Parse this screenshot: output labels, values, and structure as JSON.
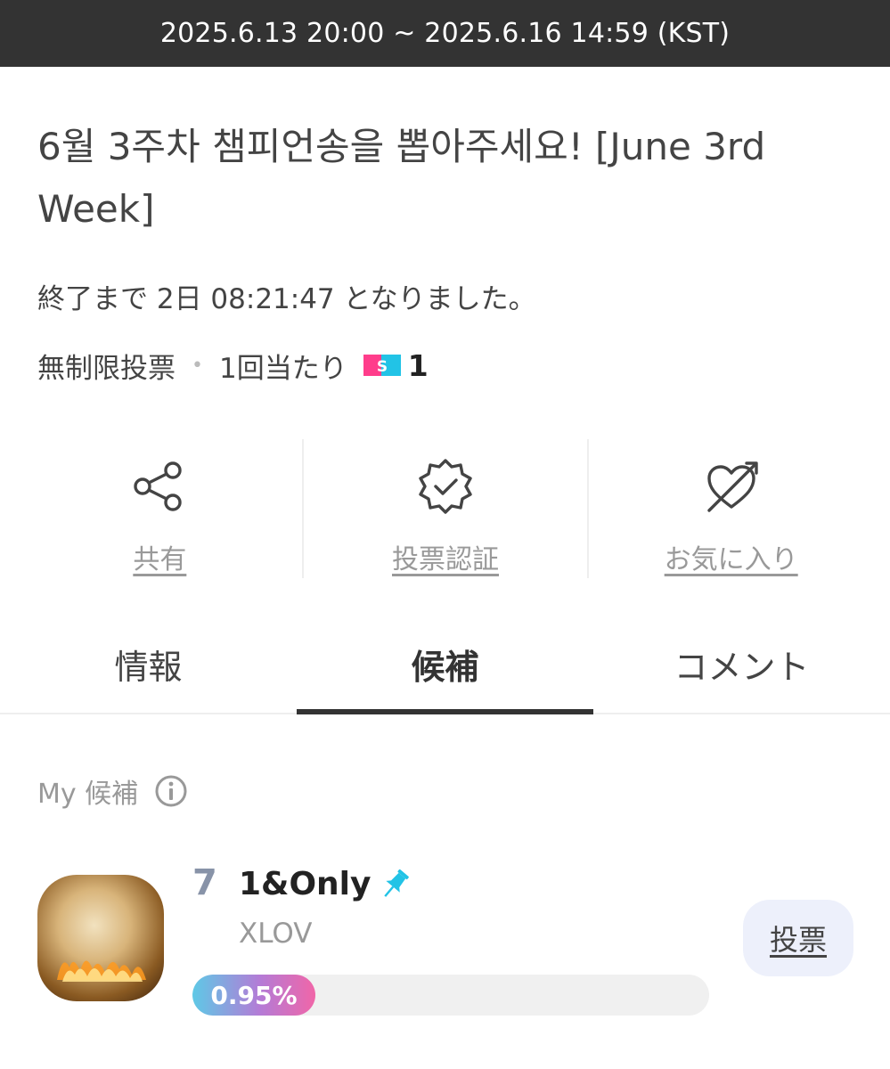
{
  "banner": {
    "period": "2025.6.13 20:00 ~ 2025.6.16 14:59 (KST)"
  },
  "vote": {
    "title": "6월 3주차 챔피언송을 뽑아주세요! [June 3rd Week]",
    "ends_in": "終了まで 2日 08:21:47 となりました。",
    "type": "無制限投票",
    "separator": "•",
    "per_vote": "1回当たり",
    "point_icon": "point-ticket-icon",
    "point_cost": "1"
  },
  "actions": [
    {
      "label": "共有",
      "icon": "share-icon"
    },
    {
      "label": "投票認証",
      "icon": "verified-badge-icon"
    },
    {
      "label": "お気に入り",
      "icon": "heart-arrow-icon"
    }
  ],
  "tabs": [
    {
      "label": "情報",
      "active": false
    },
    {
      "label": "候補",
      "active": true
    },
    {
      "label": "コメント",
      "active": false
    }
  ],
  "my_candidates": {
    "label": "My 候補",
    "info_icon": "info-icon",
    "items": [
      {
        "rank": "7",
        "song": "1&Only",
        "artist": "XLOV",
        "pinned": true,
        "percent_label": "0.95%",
        "percent": 0.95,
        "vote_label": "投票"
      }
    ]
  },
  "colors": {
    "banner_bg": "#333333",
    "progress_start": "#5ec9e6",
    "progress_end": "#f066a8",
    "pin": "#22c3e6",
    "vote_button_bg": "#edf0fb"
  }
}
